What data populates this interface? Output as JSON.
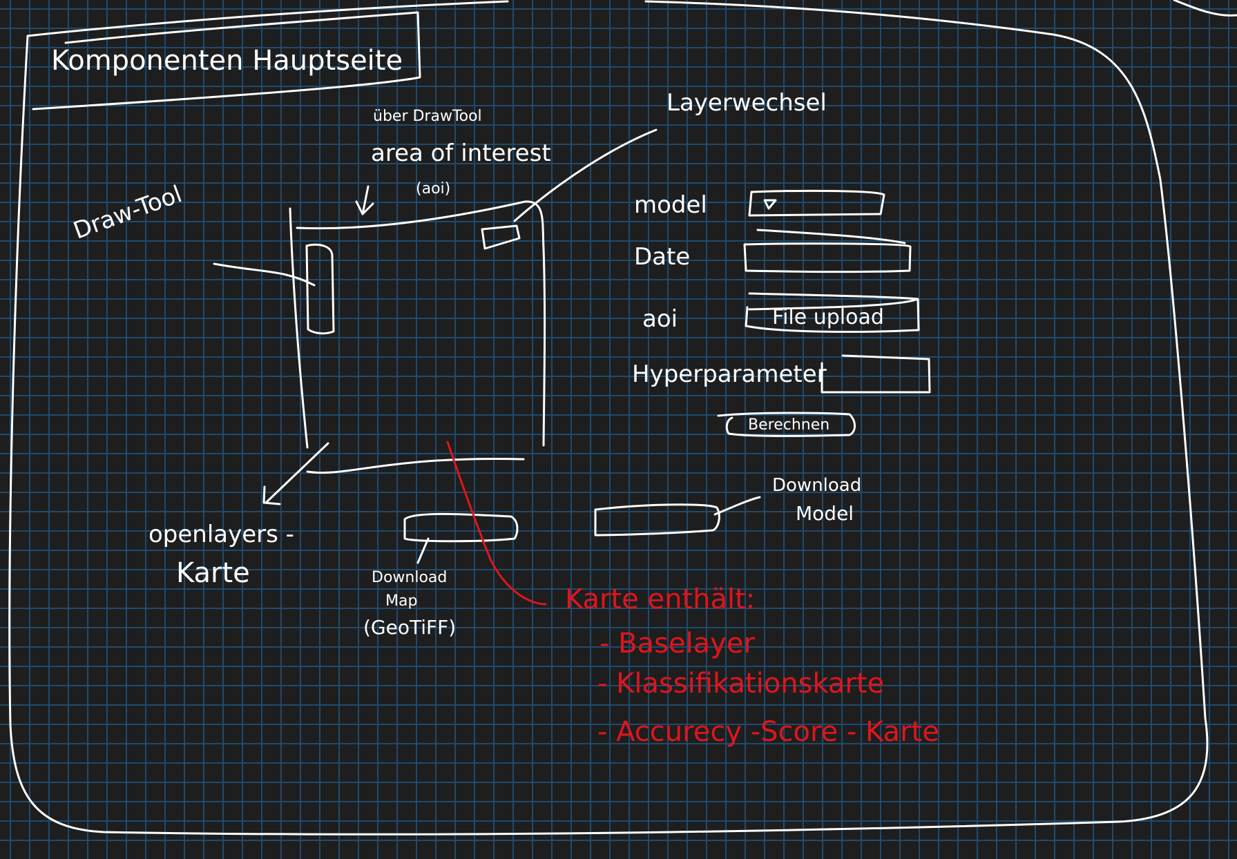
{
  "page_title": "Komponenten Hauptseite",
  "labels": {
    "uber_drawtool": "über DrawTool",
    "area_of_interest": "area of interest",
    "aoi_paren": "(aoi)",
    "layerwechsel": "Layerwechsel",
    "draw_tool": "Draw-Tool",
    "openlayers": "openlayers -",
    "karte": "Karte",
    "download_map": "Download",
    "download_map_2": "Map",
    "download_map_3": "(GeoTiFF)",
    "download_model": "Download",
    "download_model_2": "Model"
  },
  "form": {
    "model_label": "model",
    "model_dropdown_icon": "triangle-down-icon",
    "date_label": "Date",
    "aoi_label": "aoi",
    "file_upload": "File upload",
    "hyperparameter_label": "Hyperparameter",
    "berechnen_button": "Berechnen"
  },
  "map_notes": {
    "heading": "Karte enthält:",
    "items": [
      "- Baselayer",
      "- Klassifikationskarte",
      "- Accurecy -Score - Karte"
    ]
  },
  "colors": {
    "background": "#1e1e1e",
    "grid": "#1f4b6e",
    "ink": "#ffffff",
    "annotation": "#e0151d"
  }
}
